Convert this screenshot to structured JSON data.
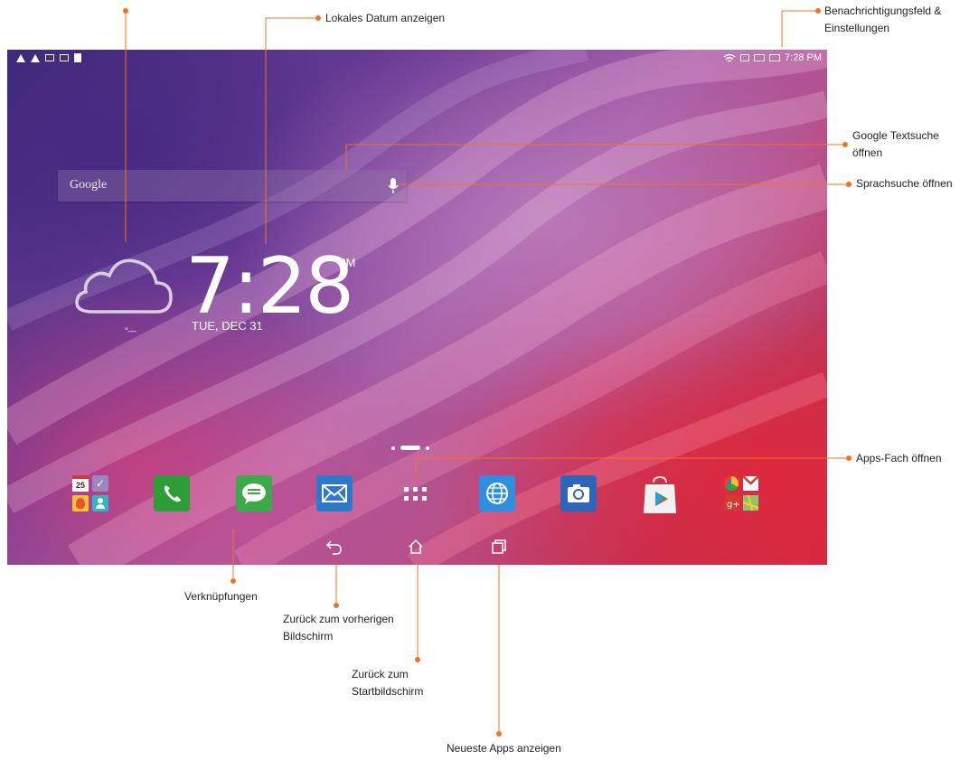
{
  "status_bar": {
    "time": "7:28 PM",
    "left_icons": [
      "warning-icon",
      "warning-icon",
      "image-icon",
      "edit-icon",
      "sd-card-icon"
    ],
    "right_icons": [
      "wifi-icon",
      "data-icon",
      "screen-icon",
      "battery-icon"
    ]
  },
  "search_bar": {
    "label": "Google",
    "mic_icon": "mic-icon"
  },
  "clock_widget": {
    "time": "7:28",
    "ampm": "PM",
    "date": "TUE, DEC 31",
    "weather_icon": "cloud-icon",
    "temperature": "°—"
  },
  "dock": {
    "items": [
      {
        "name": "shortcuts-folder",
        "icon": "folder-icon"
      },
      {
        "name": "phone",
        "icon": "phone-icon"
      },
      {
        "name": "messages",
        "icon": "message-icon"
      },
      {
        "name": "email",
        "icon": "mail-icon"
      },
      {
        "name": "apps-drawer",
        "icon": "apps-grid-icon"
      },
      {
        "name": "browser",
        "icon": "globe-icon"
      },
      {
        "name": "camera",
        "icon": "camera-icon"
      },
      {
        "name": "play-store",
        "icon": "play-store-icon"
      },
      {
        "name": "google-folder",
        "icon": "google-folder-icon"
      }
    ],
    "calendar_day": "25"
  },
  "nav_bar": {
    "icons": [
      "back-icon",
      "home-icon",
      "recents-icon"
    ]
  },
  "annotations": {
    "local_date": "Lokales Datum anzeigen",
    "notifications": "Benachrichtigungsfeld &",
    "notifications_2": "Einstellungen",
    "google_search": "Google Textsuche",
    "google_search_2": "öffnen",
    "voice_search": "Sprachsuche öffnen",
    "apps_tray": "Apps-Fach öffnen",
    "shortcuts": "Verknüpfungen",
    "back": "Zurück zum vorherigen",
    "back_2": "Bildschirm",
    "home": "Zurück zum",
    "home_2": "Startbildschirm",
    "recent": "Neueste Apps anzeigen"
  },
  "colors": {
    "accent_line": "#f47321",
    "phone_green": "#2e9d38",
    "message_green": "#3aab48",
    "mail_blue": "#2e78c9",
    "browser_blue": "#2e8ee0",
    "camera_blue": "#2f65b9"
  }
}
